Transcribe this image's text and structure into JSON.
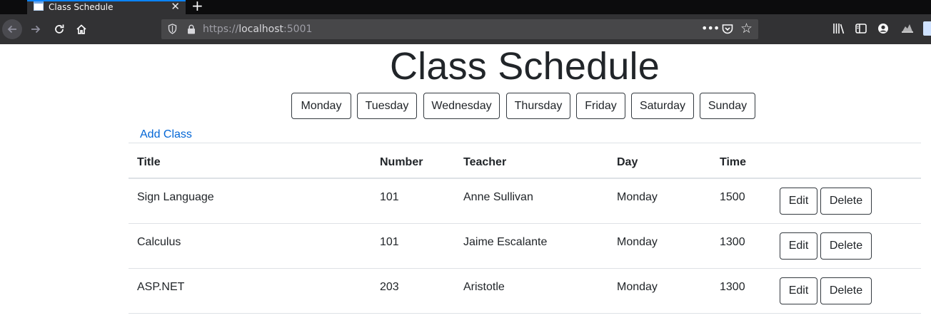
{
  "browser": {
    "tab_title": "Class Schedule",
    "url_protocol": "https://",
    "url_host": "localhost",
    "url_port": ":5001",
    "icons": {
      "favicon": "page-icon",
      "tab_close": "close-icon",
      "new_tab": "plus-icon",
      "back": "arrow-left-icon",
      "forward": "arrow-right-icon",
      "reload": "reload-icon",
      "home": "home-icon",
      "tracking": "shield-icon",
      "security": "lock-icon",
      "page_actions": "more-icon",
      "pocket": "pocket-icon",
      "bookmark": "star-icon",
      "library": "library-icon",
      "sidebar": "sidebar-icon",
      "account": "account-icon",
      "extension": "extension-icon"
    }
  },
  "page": {
    "title": "Class Schedule",
    "day_buttons": [
      "Monday",
      "Tuesday",
      "Wednesday",
      "Thursday",
      "Friday",
      "Saturday",
      "Sunday"
    ],
    "add_link": "Add Class",
    "link_color": "#0366d6",
    "table": {
      "headers": [
        "Title",
        "Number",
        "Teacher",
        "Day",
        "Time"
      ],
      "rows": [
        {
          "title": "Sign Language",
          "number": "101",
          "teacher": "Anne Sullivan",
          "day": "Monday",
          "time": "1500",
          "edit": "Edit",
          "delete": "Delete"
        },
        {
          "title": "Calculus",
          "number": "101",
          "teacher": "Jaime Escalante",
          "day": "Monday",
          "time": "1300",
          "edit": "Edit",
          "delete": "Delete"
        },
        {
          "title": "ASP.NET",
          "number": "203",
          "teacher": "Aristotle",
          "day": "Monday",
          "time": "1300",
          "edit": "Edit",
          "delete": "Delete"
        }
      ]
    }
  }
}
